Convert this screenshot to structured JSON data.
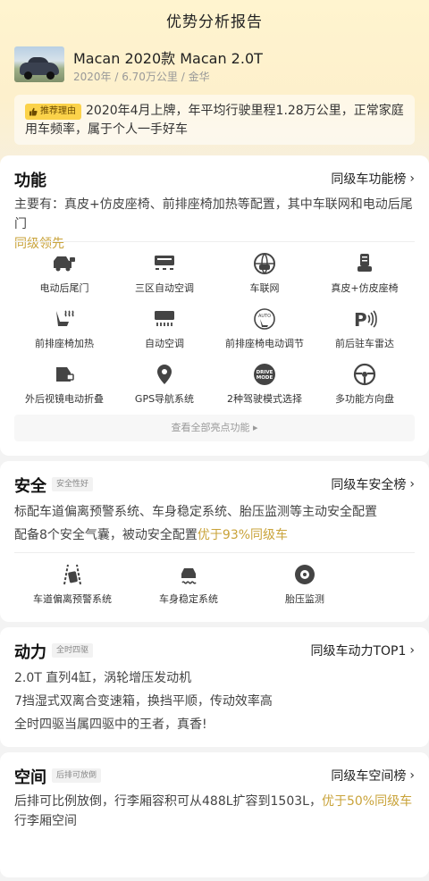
{
  "header": {
    "title": "优势分析报告",
    "car_name": "Macan 2020款 Macan 2.0T",
    "car_meta": "2020年 / 6.70万公里 / 金华",
    "reason_tag": "推荐理由",
    "reason_text": "2020年4月上牌，年平均行驶里程1.28万公里，正常家庭用车频率，属于个人一手好车"
  },
  "features": {
    "title": "功能",
    "link": "同级车功能榜",
    "desc_main": "主要有：真皮+仿皮座椅、前排座椅加热等配置，其中车联网和电动后尾门",
    "desc_highlight": "同级领先",
    "items": [
      {
        "label": "电动后尾门",
        "icon": "tailgate-icon"
      },
      {
        "label": "三区自动空调",
        "icon": "climate-icon"
      },
      {
        "label": "车联网",
        "icon": "connected-car-icon"
      },
      {
        "label": "真皮+仿皮座椅",
        "icon": "seat-icon"
      },
      {
        "label": "前排座椅加热",
        "icon": "seat-heat-icon"
      },
      {
        "label": "自动空调",
        "icon": "auto-ac-icon"
      },
      {
        "label": "前排座椅电动调节",
        "icon": "seat-adjust-icon"
      },
      {
        "label": "前后驻车雷达",
        "icon": "parking-radar-icon"
      },
      {
        "label": "外后视镜电动折叠",
        "icon": "mirror-fold-icon"
      },
      {
        "label": "GPS导航系统",
        "icon": "gps-icon"
      },
      {
        "label": "2种驾驶模式选择",
        "icon": "drive-mode-icon"
      },
      {
        "label": "多功能方向盘",
        "icon": "steering-wheel-icon"
      }
    ],
    "more": "查看全部亮点功能 ▸"
  },
  "safety": {
    "title": "安全",
    "badge": "安全性好",
    "link": "同级车安全榜",
    "line1": "标配车道偏离预警系统、车身稳定系统、胎压监测等主动安全配置",
    "line2_main": "配备8个安全气囊，被动安全配置",
    "line2_highlight": "优于93%同级车",
    "items": [
      {
        "label": "车道偏离预警系统",
        "icon": "lane-departure-icon"
      },
      {
        "label": "车身稳定系统",
        "icon": "stability-icon"
      },
      {
        "label": "胎压监测",
        "icon": "tire-pressure-icon"
      }
    ]
  },
  "power": {
    "title": "动力",
    "badge": "全时四驱",
    "link": "同级车动力TOP1",
    "lines": [
      "2.0T 直列4缸，涡轮增压发动机",
      "7挡湿式双离合变速箱，换挡平顺，传动效率高",
      "全时四驱当属四驱中的王者，真香!"
    ]
  },
  "space": {
    "title": "空间",
    "badge": "后排可放倒",
    "link": "同级车空间榜",
    "desc_main": "后排可比例放倒，行李厢容积可从488L扩容到1503L，",
    "desc_highlight": "优于50%同级车",
    "desc_tail": "行李厢空间"
  },
  "colors": {
    "accent_gold": "#c9a33a",
    "tag_yellow": "#fbd24a"
  }
}
